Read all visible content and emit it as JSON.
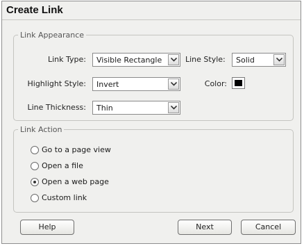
{
  "dialog": {
    "title": "Create Link"
  },
  "appearance": {
    "legend": "Link Appearance",
    "link_type_label": "Link Type:",
    "link_type_value": "Visible Rectangle",
    "line_style_label": "Line Style:",
    "line_style_value": "Solid",
    "highlight_label": "Highlight Style:",
    "highlight_value": "Invert",
    "color_label": "Color:",
    "color_value": "#000000",
    "thickness_label": "Line Thickness:",
    "thickness_value": "Thin"
  },
  "action": {
    "legend": "Link Action",
    "options": [
      {
        "label": "Go to a page view",
        "selected": false
      },
      {
        "label": "Open a file",
        "selected": false
      },
      {
        "label": "Open a web page",
        "selected": true
      },
      {
        "label": "Custom link",
        "selected": false
      }
    ]
  },
  "buttons": {
    "help": "Help",
    "next": "Next",
    "cancel": "Cancel"
  }
}
